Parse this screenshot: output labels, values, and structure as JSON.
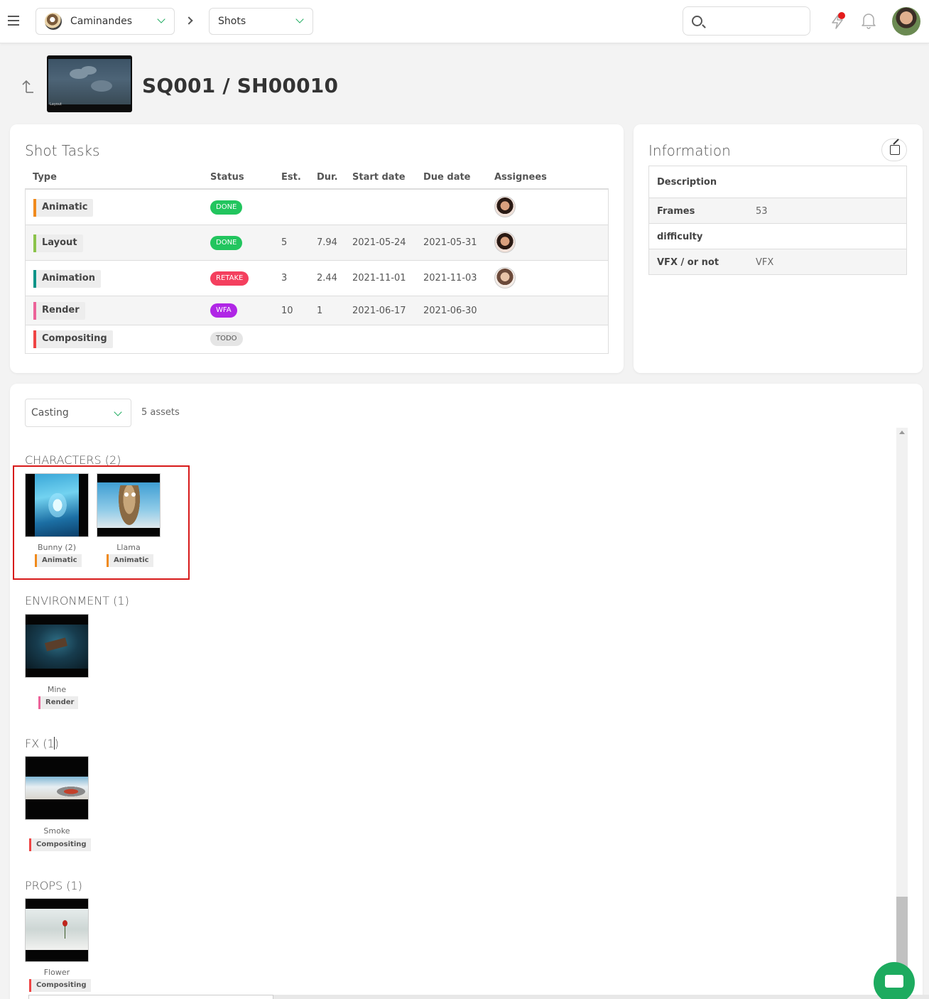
{
  "topbar": {
    "production": "Caminandes",
    "section": "Shots",
    "search_placeholder": ""
  },
  "header": {
    "title": "SQ001 / SH00010",
    "thumb_label": "Layout"
  },
  "tasks": {
    "title": "Shot Tasks",
    "columns": [
      "Type",
      "Status",
      "Est.",
      "Dur.",
      "Start date",
      "Due date",
      "Assignees"
    ],
    "rows": [
      {
        "type": "Animatic",
        "type_color": "#f08a1c",
        "status": "DONE",
        "status_color": "#22c55e",
        "est": "",
        "dur": "",
        "start": "",
        "due": "",
        "assignee": true
      },
      {
        "type": "Layout",
        "type_color": "#8bc34a",
        "status": "DONE",
        "status_color": "#22c55e",
        "est": "5",
        "dur": "7.94",
        "start": "2021-05-24",
        "due": "2021-05-31",
        "assignee": true
      },
      {
        "type": "Animation",
        "type_color": "#0d9488",
        "status": "RETAKE",
        "status_color": "#f43f5e",
        "est": "3",
        "dur": "2.44",
        "start": "2021-11-01",
        "due": "2021-11-03",
        "assignee": true
      },
      {
        "type": "Render",
        "type_color": "#ec6399",
        "status": "WFA",
        "status_color": "#b026e6",
        "est": "10",
        "dur": "1",
        "start": "2021-06-17",
        "due": "2021-06-30",
        "assignee": false
      },
      {
        "type": "Compositing",
        "type_color": "#ef4444",
        "status": "TODO",
        "status_color": "#e5e5e5",
        "est": "",
        "dur": "",
        "start": "",
        "due": "",
        "assignee": false
      }
    ]
  },
  "info": {
    "title": "Information",
    "rows": [
      {
        "label": "Description",
        "value": ""
      },
      {
        "label": "Frames",
        "value": "53"
      },
      {
        "label": "difficulty",
        "value": ""
      },
      {
        "label": "VFX / or not",
        "value": "VFX"
      }
    ]
  },
  "casting": {
    "select": "Casting",
    "count": "5 assets",
    "groups": [
      {
        "title": "CHARACTERS (2)",
        "assets": [
          {
            "name": "Bunny (2)",
            "task": "Animatic",
            "task_color": "#f08a1c"
          },
          {
            "name": "Llama",
            "task": "Animatic",
            "task_color": "#f08a1c"
          }
        ]
      },
      {
        "title": "ENVIRONMENT (1)",
        "assets": [
          {
            "name": "Mine",
            "task": "Render",
            "task_color": "#ec6399"
          }
        ]
      },
      {
        "title": "FX (1)",
        "assets": [
          {
            "name": "Smoke",
            "task": "Compositing",
            "task_color": "#ef4444"
          }
        ]
      },
      {
        "title": "PROPS (1)",
        "assets": [
          {
            "name": "Flower",
            "task": "Compositing",
            "task_color": "#ef4444"
          }
        ]
      }
    ]
  }
}
